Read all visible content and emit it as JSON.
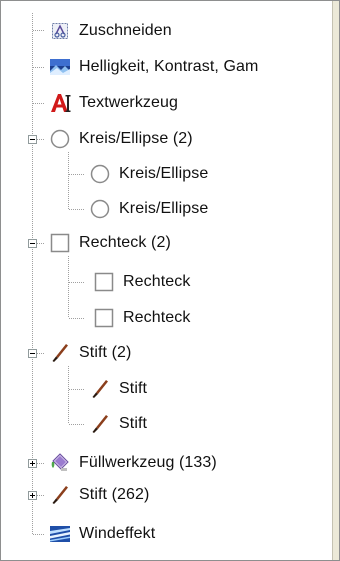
{
  "tree": {
    "nodes": [
      {
        "label": "Zuschneiden",
        "icon": "crop-icon"
      },
      {
        "label": "Helligkeit, Kontrast, Gam",
        "icon": "brightness-contrast-icon"
      },
      {
        "label": "Textwerkzeug",
        "icon": "text-tool-icon"
      },
      {
        "label": "Kreis/Ellipse (2)",
        "icon": "ellipse-icon",
        "state": "expanded"
      },
      {
        "label": "Kreis/Ellipse",
        "icon": "ellipse-icon"
      },
      {
        "label": "Kreis/Ellipse",
        "icon": "ellipse-icon"
      },
      {
        "label": "Rechteck (2)",
        "icon": "rectangle-icon",
        "state": "expanded"
      },
      {
        "label": "Rechteck",
        "icon": "rectangle-icon"
      },
      {
        "label": "Rechteck",
        "icon": "rectangle-icon"
      },
      {
        "label": "Stift (2)",
        "icon": "pen-icon",
        "state": "expanded"
      },
      {
        "label": "Stift",
        "icon": "pen-icon"
      },
      {
        "label": "Stift",
        "icon": "pen-icon"
      },
      {
        "label": "Füllwerkzeug (133)",
        "icon": "fill-bucket-icon",
        "state": "collapsed"
      },
      {
        "label": "Stift (262)",
        "icon": "pen-icon",
        "state": "collapsed"
      },
      {
        "label": "Windeffekt",
        "icon": "wind-effect-icon"
      }
    ]
  }
}
